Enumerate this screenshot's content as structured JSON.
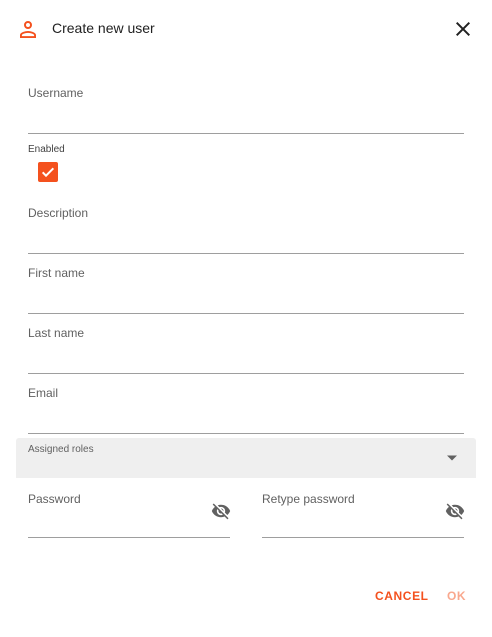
{
  "dialog": {
    "title": "Create new user",
    "icon": "user-icon",
    "close_icon": "close-icon"
  },
  "fields": {
    "username": {
      "label": "Username",
      "value": ""
    },
    "enabled": {
      "label": "Enabled",
      "checked": true
    },
    "description": {
      "label": "Description",
      "value": ""
    },
    "first_name": {
      "label": "First name",
      "value": ""
    },
    "last_name": {
      "label": "Last name",
      "value": ""
    },
    "email": {
      "label": "Email",
      "value": ""
    },
    "assigned_roles": {
      "label": "Assigned roles",
      "value": ""
    },
    "password": {
      "label": "Password",
      "value": "",
      "icon": "visibility-off-icon"
    },
    "retype_password": {
      "label": "Retype password",
      "value": "",
      "icon": "visibility-off-icon"
    }
  },
  "actions": {
    "cancel_label": "CANCEL",
    "ok_label": "OK"
  },
  "colors": {
    "accent": "#f4511e",
    "accent_disabled": "#f9a88e",
    "underline": "#9e9e9e",
    "select_bg": "#efefef"
  }
}
